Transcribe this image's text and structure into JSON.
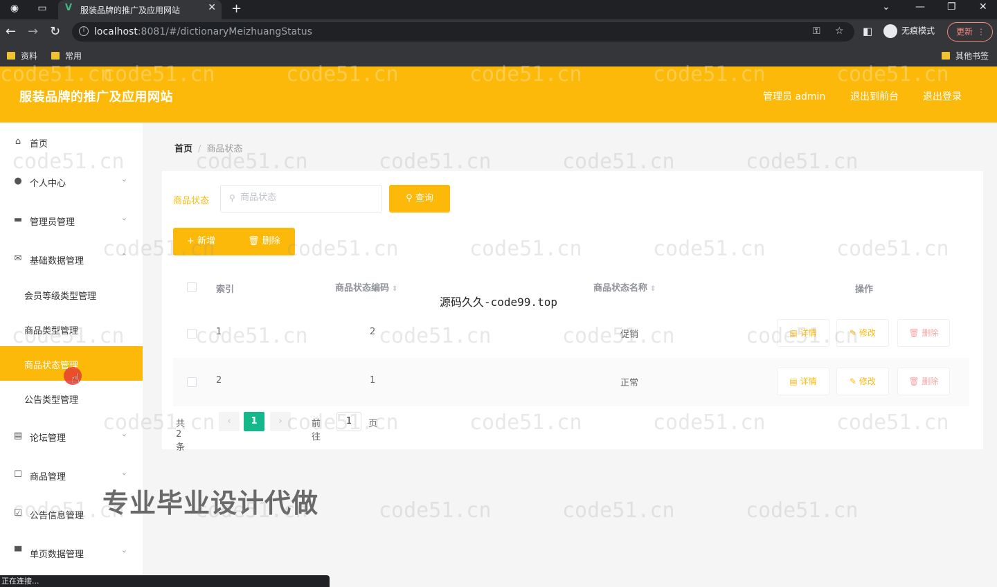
{
  "browser": {
    "tab_title": "服装品牌的推广及应用网站",
    "tab_favicon": "V",
    "url_host": "localhost",
    "url_path": ":8081/#/dictionaryMeizhuangStatus",
    "incognito_label": "无痕模式",
    "update_label": "更新",
    "bookmarks": [
      "资料",
      "常用"
    ],
    "other_bookmarks": "其他书签",
    "status": "正在连接..."
  },
  "header": {
    "title": "服装品牌的推广及应用网站",
    "admin_label": "管理员 admin",
    "back_front": "退出到前台",
    "logout": "退出登录"
  },
  "sidebar": {
    "items": [
      {
        "label": "首页",
        "icon": "home-icon"
      },
      {
        "label": "个人中心",
        "icon": "user-icon"
      },
      {
        "label": "管理员管理",
        "icon": "briefcase-icon"
      },
      {
        "label": "基础数据管理",
        "icon": "mail-icon"
      }
    ],
    "sub_items": [
      "会员等级类型管理",
      "商品类型管理",
      "商品状态管理",
      "公告类型管理"
    ],
    "more_items": [
      {
        "label": "论坛管理",
        "icon": "document-icon"
      },
      {
        "label": "商品管理",
        "icon": "chat-icon"
      },
      {
        "label": "公告信息管理",
        "icon": "checklist-icon"
      },
      {
        "label": "单页数据管理",
        "icon": "monitor-icon"
      }
    ]
  },
  "breadcrumb": {
    "home": "首页",
    "sep": "/",
    "current": "商品状态"
  },
  "search": {
    "label": "商品状态",
    "placeholder": "商品状态",
    "query_label": "查询"
  },
  "actions": {
    "add_label": "新增",
    "delete_label": "删除"
  },
  "table": {
    "headers": [
      "索引",
      "商品状态编码",
      "商品状态名称",
      "操作"
    ],
    "rows": [
      {
        "index": "1",
        "code": "2",
        "name": "促销"
      },
      {
        "index": "2",
        "code": "1",
        "name": "正常"
      }
    ],
    "op_labels": {
      "detail": "详情",
      "edit": "修改",
      "remove": "删除"
    }
  },
  "pagination": {
    "total": "共 2 条",
    "page": "1",
    "goto": "前往",
    "goto_value": "1",
    "page_suffix": "页"
  },
  "overlays": {
    "mono": "源码久久-code99.top",
    "promo": "专业毕业设计代做"
  },
  "watermark_text": "code51.cn",
  "colors": {
    "primary": "#fdb909",
    "active_page": "#14b88a"
  }
}
